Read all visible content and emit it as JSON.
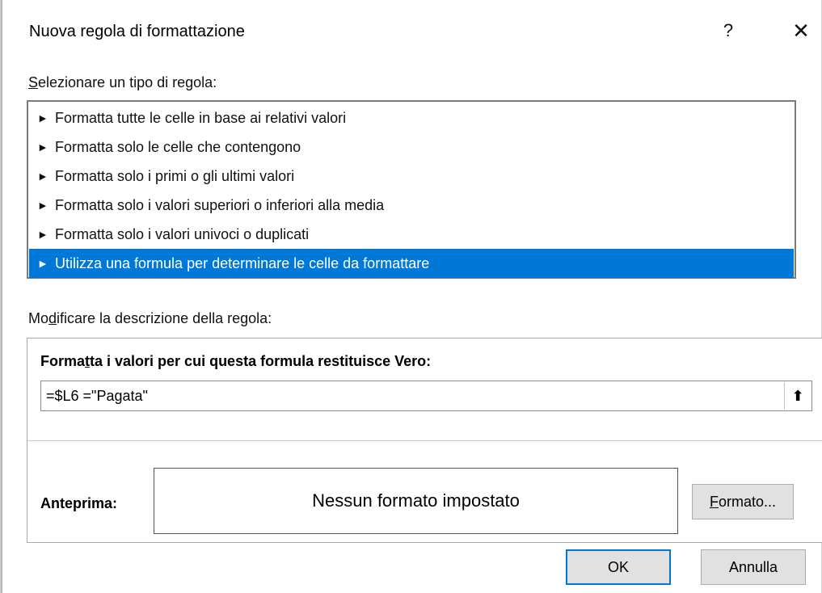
{
  "dialog": {
    "title": "Nuova regola di formattazione",
    "help_glyph": "?",
    "close_glyph": "✕"
  },
  "rule_type": {
    "label_underlined": "S",
    "label_rest": "elezionare un tipo di regola:",
    "items": [
      {
        "label": "Formatta tutte le celle in base ai relativi valori",
        "selected": false
      },
      {
        "label": "Formatta solo le celle che contengono",
        "selected": false
      },
      {
        "label": "Formatta solo i primi o gli ultimi valori",
        "selected": false
      },
      {
        "label": "Formatta solo i valori superiori o inferiori alla media",
        "selected": false
      },
      {
        "label": "Formatta solo i valori univoci o duplicati",
        "selected": false
      },
      {
        "label": "Utilizza una formula per determinare le celle da formattare",
        "selected": true
      }
    ]
  },
  "description": {
    "label_pre": "Mo",
    "label_underlined": "d",
    "label_post": "ificare la descrizione della regola:",
    "formula_label_pre": "Forma",
    "formula_label_underlined": "t",
    "formula_label_post": "ta i valori per cui questa formula restituisce Vero:",
    "formula_value": "=$L6 =\"Pagata\"",
    "collapse_icon": "⬆",
    "preview_label": "Anteprima:",
    "preview_text": "Nessun formato impostato",
    "format_button_underlined": "F",
    "format_button_rest": "ormato..."
  },
  "buttons": {
    "ok": "OK",
    "cancel": "Annulla"
  },
  "colors": {
    "selection": "#0078d7"
  }
}
